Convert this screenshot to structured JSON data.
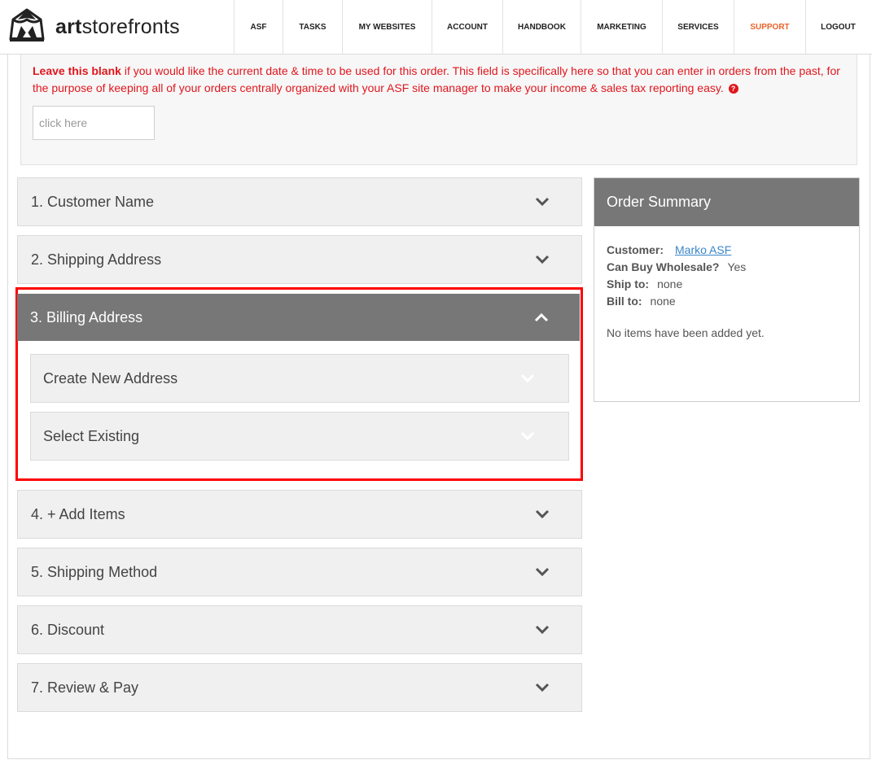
{
  "header": {
    "brand": "artstorefronts",
    "nav": [
      {
        "label": "ASF",
        "width": 60
      },
      {
        "label": "TASKS",
        "width": 73
      },
      {
        "label": "MY WEBSITES",
        "width": 110
      },
      {
        "label": "ACCOUNT",
        "width": 87
      },
      {
        "label": "HANDBOOK",
        "width": 96
      },
      {
        "label": "MARKETING",
        "width": 100
      },
      {
        "label": "SERVICES",
        "width": 88
      },
      {
        "label": "SUPPORT",
        "width": 88
      },
      {
        "label": "LOGOUT",
        "width": 80
      }
    ],
    "active_nav": "SUPPORT",
    "active_color": "#e8632b"
  },
  "date_section": {
    "emphasis": "Leave this blank",
    "text": " if you would like the current date & time to be used for this order. This field is specifically here so that you can enter in orders from the past, for the purpose of keeping all of your orders centrally organized with your ASF site manager to make your income & sales tax reporting easy.",
    "help_icon": "question-circle-icon",
    "input_placeholder": "click here"
  },
  "steps": {
    "customer_name": "1. Customer Name",
    "shipping_address": "2. Shipping Address",
    "billing_address": "3. Billing Address",
    "add_items": "4. + Add Items",
    "shipping_method": "5. Shipping Method",
    "discount": "6. Discount",
    "review_pay": "7. Review & Pay"
  },
  "billing_options": {
    "create_new": "Create New Address",
    "select_existing": "Select Existing"
  },
  "summary": {
    "title": "Order Summary",
    "customer_label": "Customer:",
    "customer_value": "Marko ASF",
    "wholesale_label": "Can Buy Wholesale?",
    "wholesale_value": "Yes",
    "ship_label": "Ship to:",
    "ship_value": "none",
    "bill_label": "Bill to:",
    "bill_value": "none",
    "empty_message": "No items have been added yet."
  },
  "colors": {
    "header_bar": "#777777",
    "highlight": "#ff0000",
    "warning_text": "#e0161d",
    "link": "#3a86c8"
  }
}
